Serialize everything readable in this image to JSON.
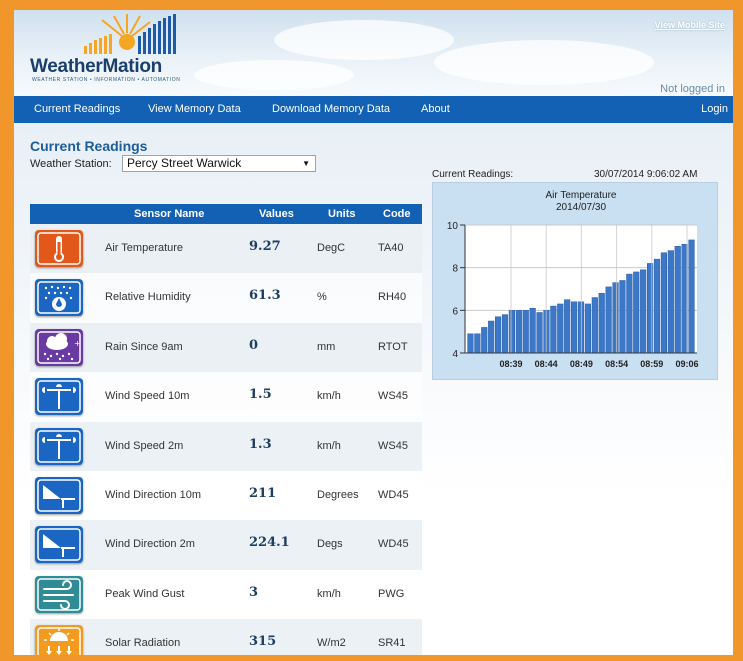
{
  "header": {
    "logo": {
      "brand": "WeatherMation",
      "tagline": "WEATHER STATION • INFORMATION • AUTOMATION"
    },
    "mobile_link": "View Mobile Site",
    "login_status": "Not logged in"
  },
  "nav": {
    "items": [
      "Current Readings",
      "View Memory Data",
      "Download Memory Data",
      "About"
    ],
    "login": "Login"
  },
  "page": {
    "title": "Current Readings",
    "station_label": "Weather Station:",
    "station_value": "Percy Street Warwick"
  },
  "table": {
    "headers": {
      "name": "Sensor Name",
      "value": "Values",
      "units": "Units",
      "code": "Code"
    },
    "rows": [
      {
        "icon": "thermometer-icon",
        "name": "Air Temperature",
        "value": "9.27",
        "units": "DegC",
        "code": "TA40",
        "color": "#e2581a"
      },
      {
        "icon": "humidity-icon",
        "name": "Relative Humidity",
        "value": "61.3",
        "units": "%",
        "code": "RH40",
        "color": "#1a66c2"
      },
      {
        "icon": "rain-cloud-icon",
        "name": "Rain Since 9am",
        "value": "0",
        "units": "mm",
        "code": "RTOT",
        "color": "#6a3aa4"
      },
      {
        "icon": "anemometer-icon",
        "name": "Wind Speed 10m",
        "value": "1.5",
        "units": "km/h",
        "code": "WS45",
        "color": "#1a66c2"
      },
      {
        "icon": "anemometer-icon",
        "name": "Wind Speed 2m",
        "value": "1.3",
        "units": "km/h",
        "code": "WS45",
        "color": "#1a66c2"
      },
      {
        "icon": "wind-vane-icon",
        "name": "Wind Direction 10m",
        "value": "211",
        "units": "Degrees",
        "code": "WD45",
        "color": "#1a66c2"
      },
      {
        "icon": "wind-vane-icon",
        "name": "Wind Direction 2m",
        "value": "224.1",
        "units": "Degs",
        "code": "WD45",
        "color": "#1a66c2"
      },
      {
        "icon": "wind-gust-icon",
        "name": "Peak Wind Gust",
        "value": "3",
        "units": "km/h",
        "code": "PWG",
        "color": "#2f8c96"
      },
      {
        "icon": "sun-icon",
        "name": "Solar Radiation",
        "value": "315",
        "units": "W/m2",
        "code": "SR41",
        "color": "#f39b1e"
      }
    ]
  },
  "chart_panel": {
    "label": "Current Readings:",
    "timestamp": "30/07/2014 9:06:02 AM"
  },
  "chart_data": {
    "type": "bar",
    "title": "Air Temperature",
    "subtitle": "2014/07/30",
    "ylim": [
      4,
      10
    ],
    "yticks": [
      4,
      6,
      8,
      10
    ],
    "xticks": [
      "08:39",
      "08:44",
      "08:49",
      "08:54",
      "08:59",
      "09:06"
    ],
    "grid": true,
    "bar_color": "#3d78c8",
    "values": [
      4.9,
      4.9,
      5.2,
      5.5,
      5.7,
      5.8,
      6.0,
      6.0,
      6.0,
      6.1,
      5.9,
      6.0,
      6.2,
      6.3,
      6.5,
      6.4,
      6.4,
      6.3,
      6.6,
      6.8,
      7.1,
      7.3,
      7.4,
      7.7,
      7.8,
      7.9,
      8.2,
      8.4,
      8.7,
      8.8,
      9.0,
      9.1,
      9.3
    ]
  }
}
